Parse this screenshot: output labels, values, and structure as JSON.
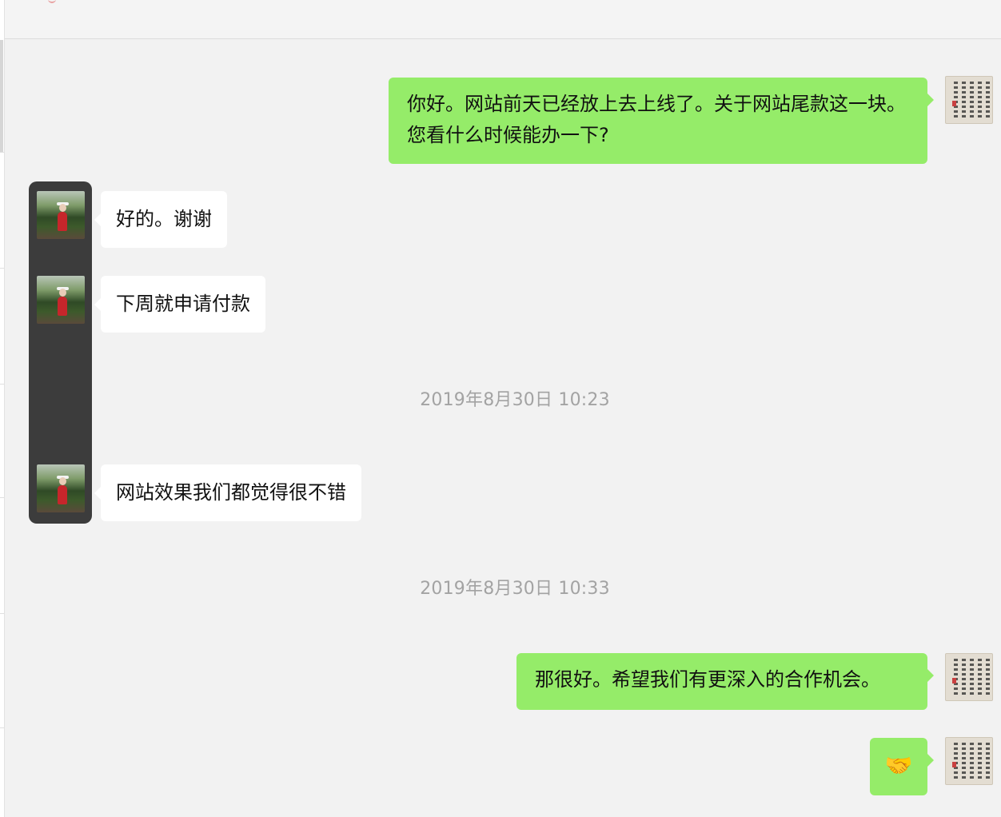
{
  "conversation": {
    "messages": [
      {
        "sender": "self",
        "text": "你好。网站前天已经放上去上线了。关于网站尾款这一块。您看什么时候能办一下?"
      },
      {
        "sender": "contact",
        "text": "好的。谢谢"
      },
      {
        "sender": "contact",
        "text": "下周就申请付款"
      },
      {
        "timestamp": "2019年8月30日 10:23"
      },
      {
        "sender": "contact",
        "text": "网站效果我们都觉得很不错"
      },
      {
        "timestamp": "2019年8月30日 10:33"
      },
      {
        "sender": "self",
        "text": "那很好。希望我们有更深入的合作机会。"
      },
      {
        "sender": "self",
        "emoji": "🤝",
        "icon": "handshake-emoji"
      }
    ]
  },
  "colors": {
    "background": "#f2f2f2",
    "outgoing_bubble": "#95ec69",
    "incoming_bubble": "#ffffff",
    "timestamp_text": "#a3a3a3",
    "avatar_strip": "#3c3c3c"
  }
}
